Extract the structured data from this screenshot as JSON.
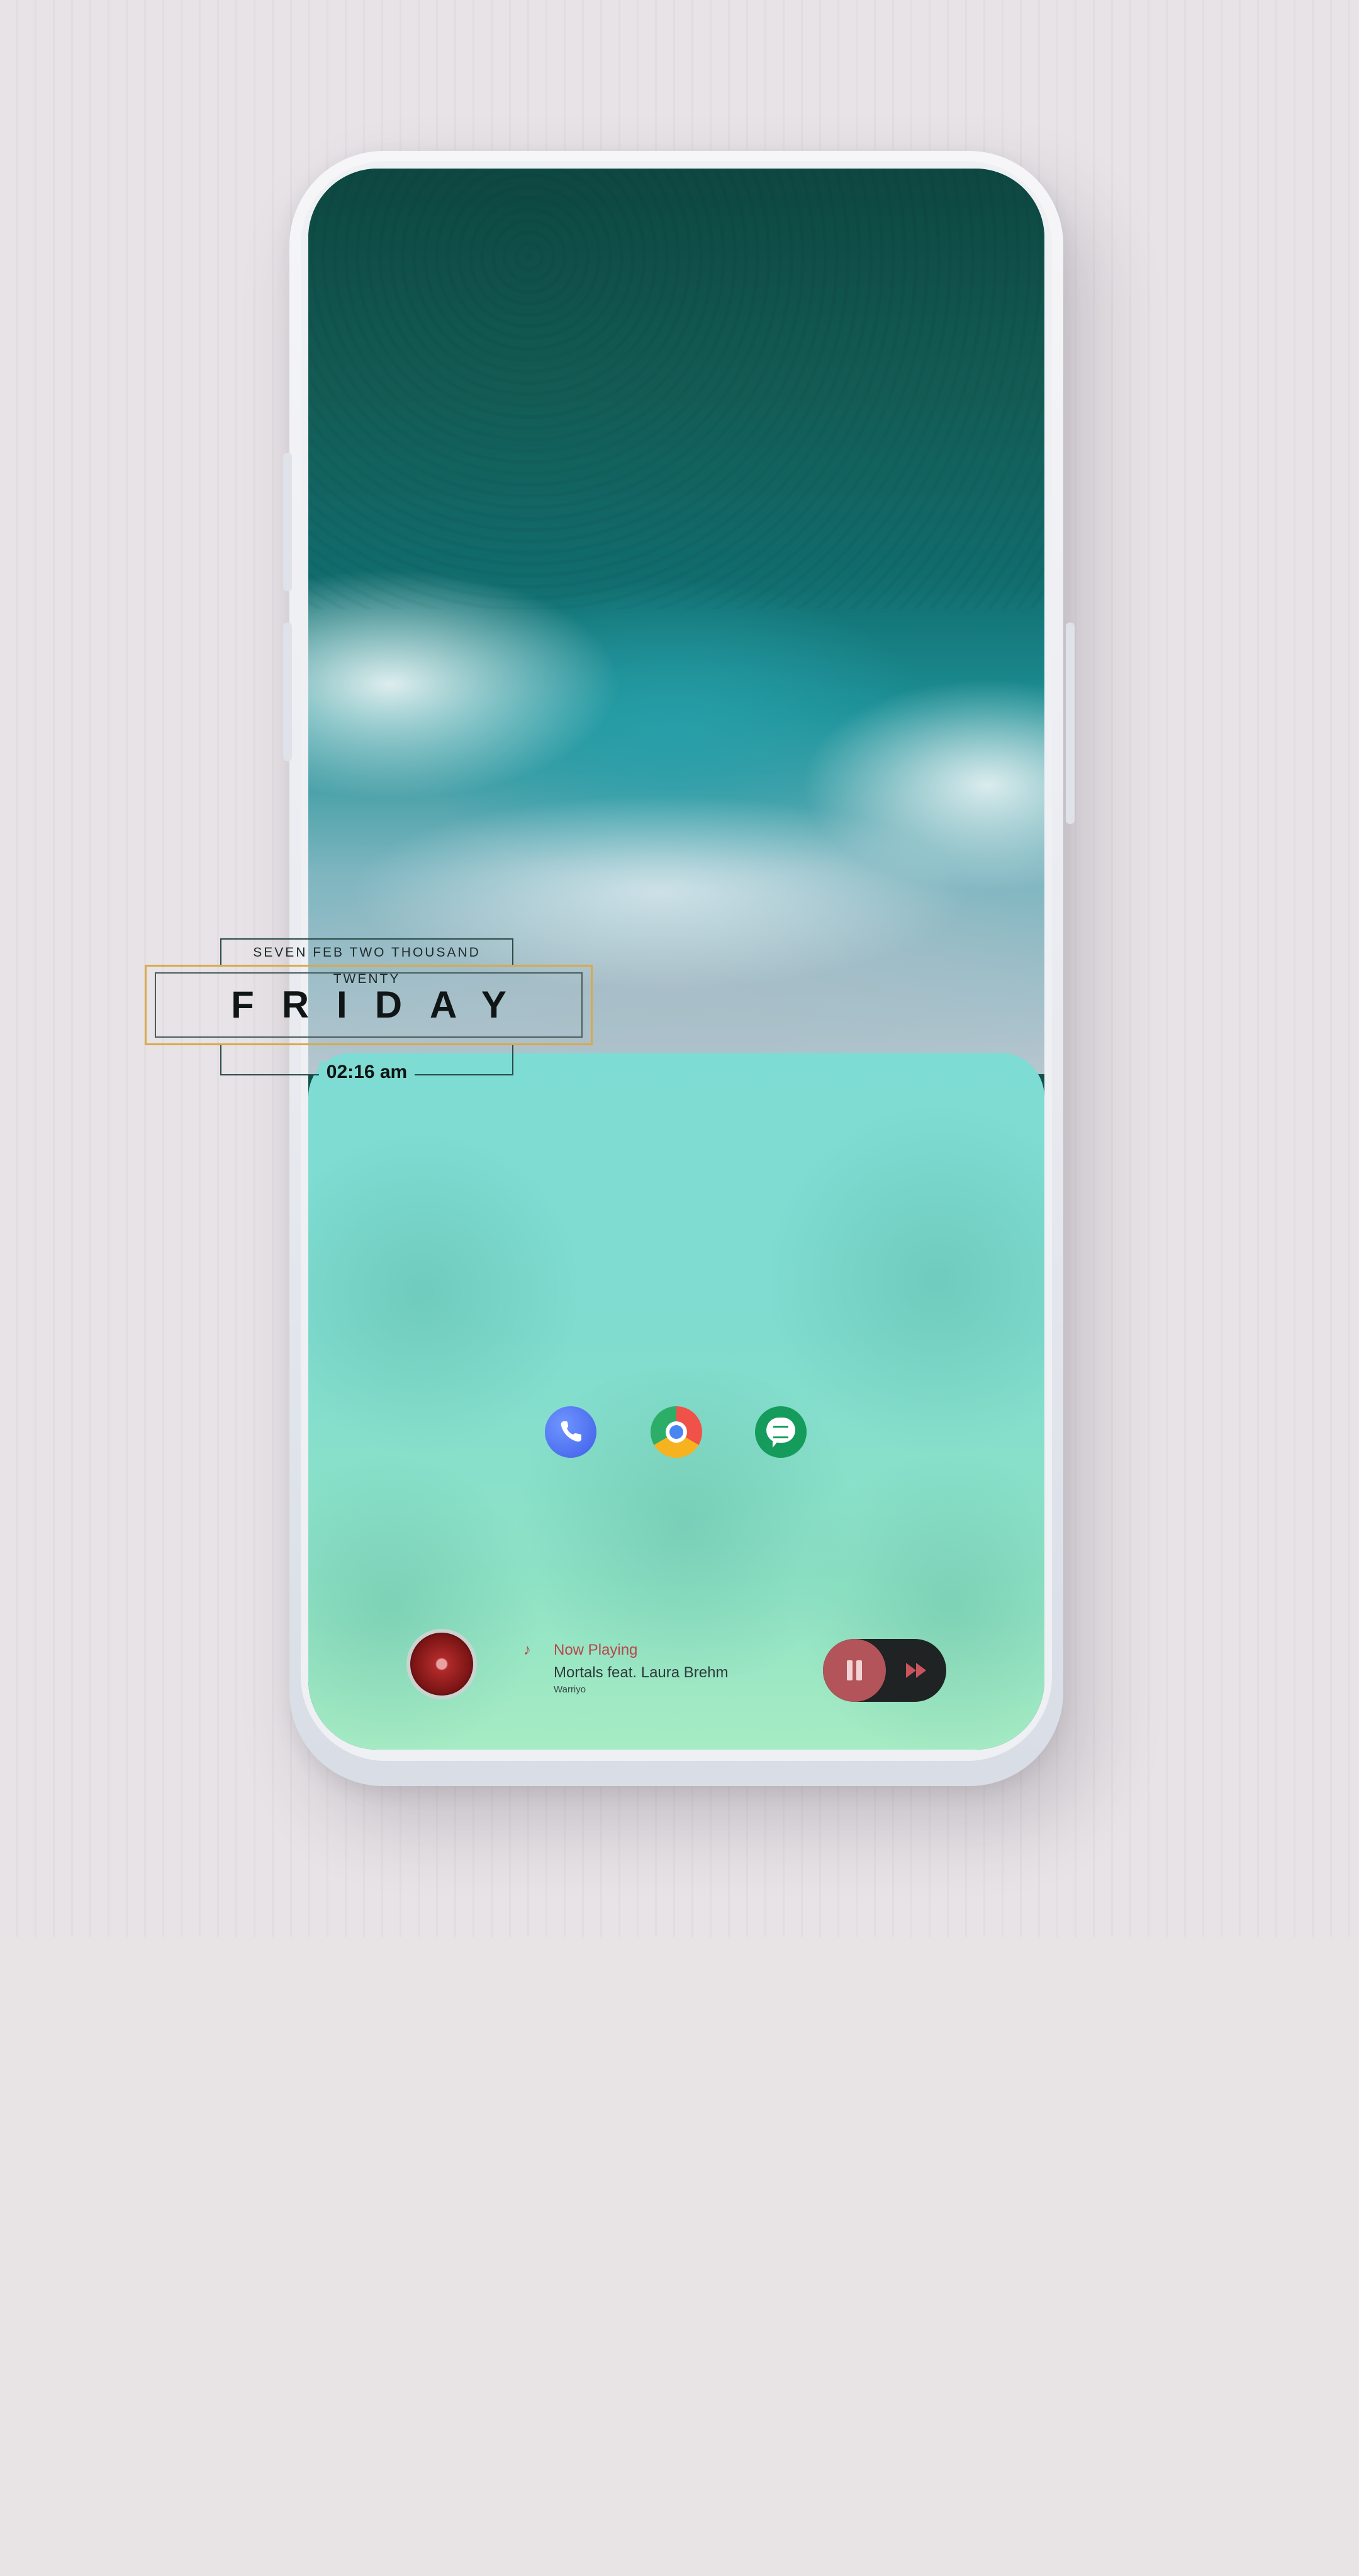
{
  "date_widget": {
    "date_text": "SEVEN FEB TWO THOUSAND TWENTY",
    "day": "FRIDAY",
    "time": "02:16 am"
  },
  "dock": {
    "apps": [
      {
        "name": "phone",
        "icon": "phone-icon"
      },
      {
        "name": "chrome",
        "icon": "chrome-icon"
      },
      {
        "name": "messages",
        "icon": "messages-icon"
      }
    ]
  },
  "music": {
    "status": "Now Playing",
    "title": "Mortals feat. Laura Brehm",
    "artist": "Warriyo",
    "note_icon": "♪"
  },
  "colors": {
    "accent": "#b8464a",
    "frame_gold": "#d9a94b",
    "panel_teal": "#7ddcd4"
  }
}
